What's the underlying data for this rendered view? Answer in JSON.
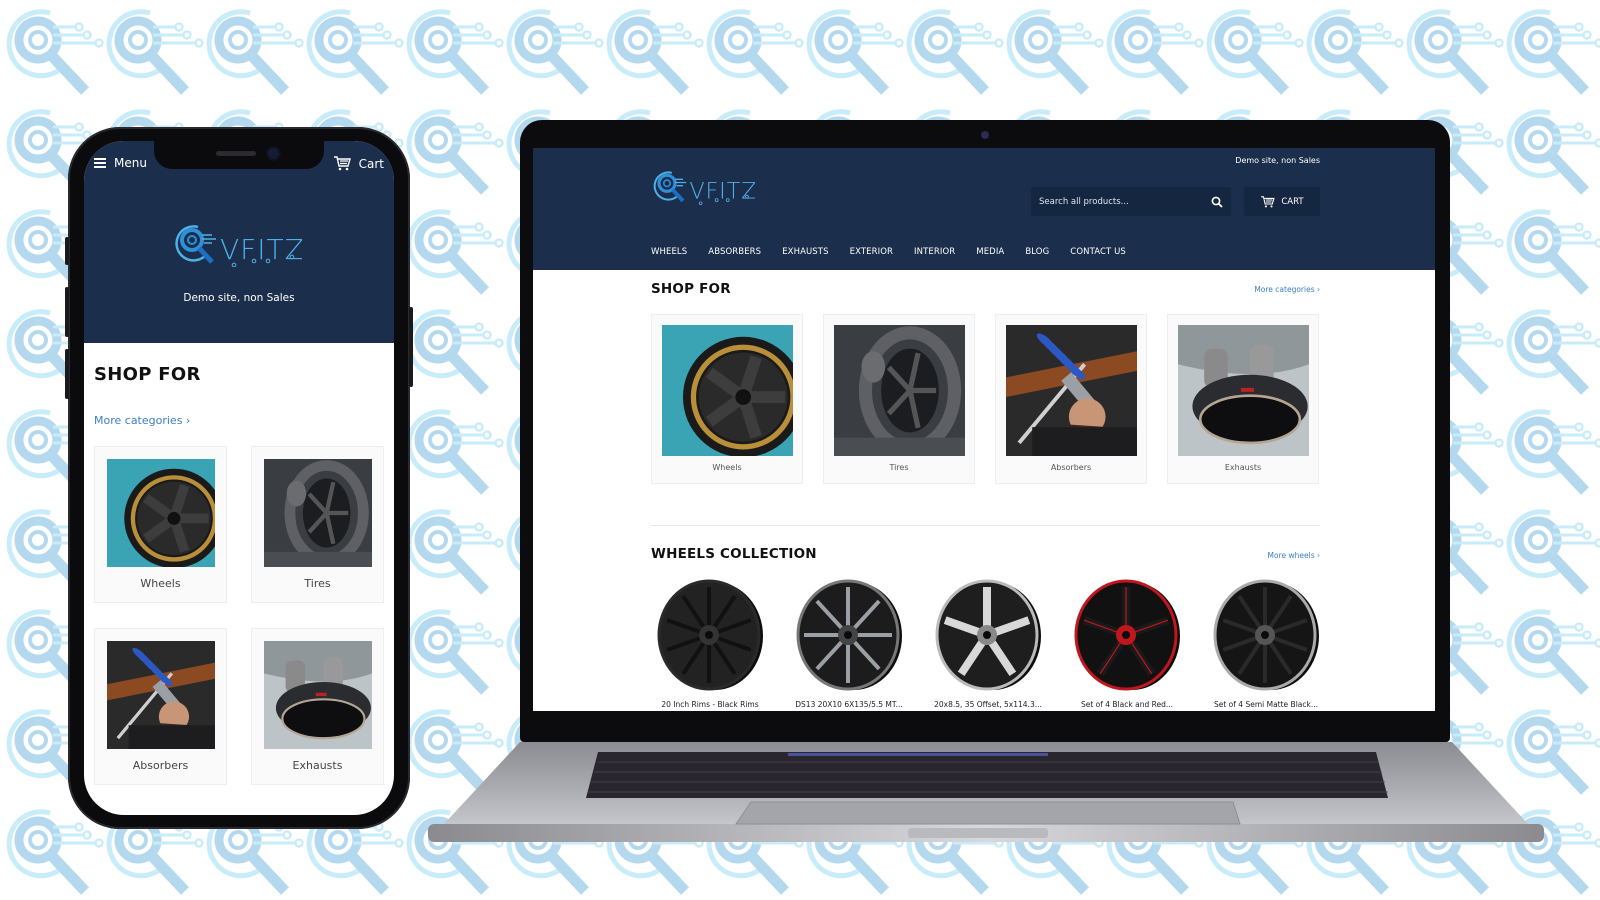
{
  "colors": {
    "header_bg": "#1b2e4b",
    "search_bg": "#142640",
    "link": "#3a7fc7",
    "pattern_light": "#b4d9ee",
    "pattern_ring": "#c9ecfa"
  },
  "brand": {
    "logo_text": "VFITZ",
    "tagline": "Demo site, non Sales"
  },
  "mobile": {
    "menu_label": "Menu",
    "cart_label": "Cart",
    "tagline": "Demo site, non Sales",
    "section_title": "SHOP FOR",
    "more_link": "More categories ›",
    "categories": [
      {
        "label": "Wheels",
        "icon": "wheel-photo"
      },
      {
        "label": "Tires",
        "icon": "tire-sculpture-photo"
      },
      {
        "label": "Absorbers",
        "icon": "shock-absorber-photo"
      },
      {
        "label": "Exhausts",
        "icon": "exhaust-tip-photo"
      }
    ]
  },
  "desktop": {
    "tagline": "Demo site, non Sales",
    "search": {
      "placeholder": "Search all products..."
    },
    "cart_label": "CART",
    "nav": [
      "WHEELS",
      "ABSORBERS",
      "EXHAUSTS",
      "EXTERIOR",
      "INTERIOR",
      "MEDIA",
      "BLOG",
      "CONTACT US"
    ],
    "shop_for": {
      "title": "SHOP FOR",
      "more_link": "More categories ›",
      "categories": [
        {
          "label": "Wheels"
        },
        {
          "label": "Tires"
        },
        {
          "label": "Absorbers"
        },
        {
          "label": "Exhausts"
        }
      ]
    },
    "wheels_collection": {
      "title": "WHEELS COLLECTION",
      "more_link": "More wheels ›",
      "products": [
        {
          "title": "20 Inch Rims - Black Rims",
          "style": "black-multispoke"
        },
        {
          "title": "DS13 20X10 6X135/5.5 MT...",
          "style": "black-milled"
        },
        {
          "title": "20x8.5, 35 Offset, 5x114.3...",
          "style": "silver-5-spoke"
        },
        {
          "title": "Set of 4 Black and Red...",
          "style": "black-red"
        },
        {
          "title": "Set of 4 Semi Matte Black...",
          "style": "black-10-spoke"
        }
      ]
    }
  }
}
